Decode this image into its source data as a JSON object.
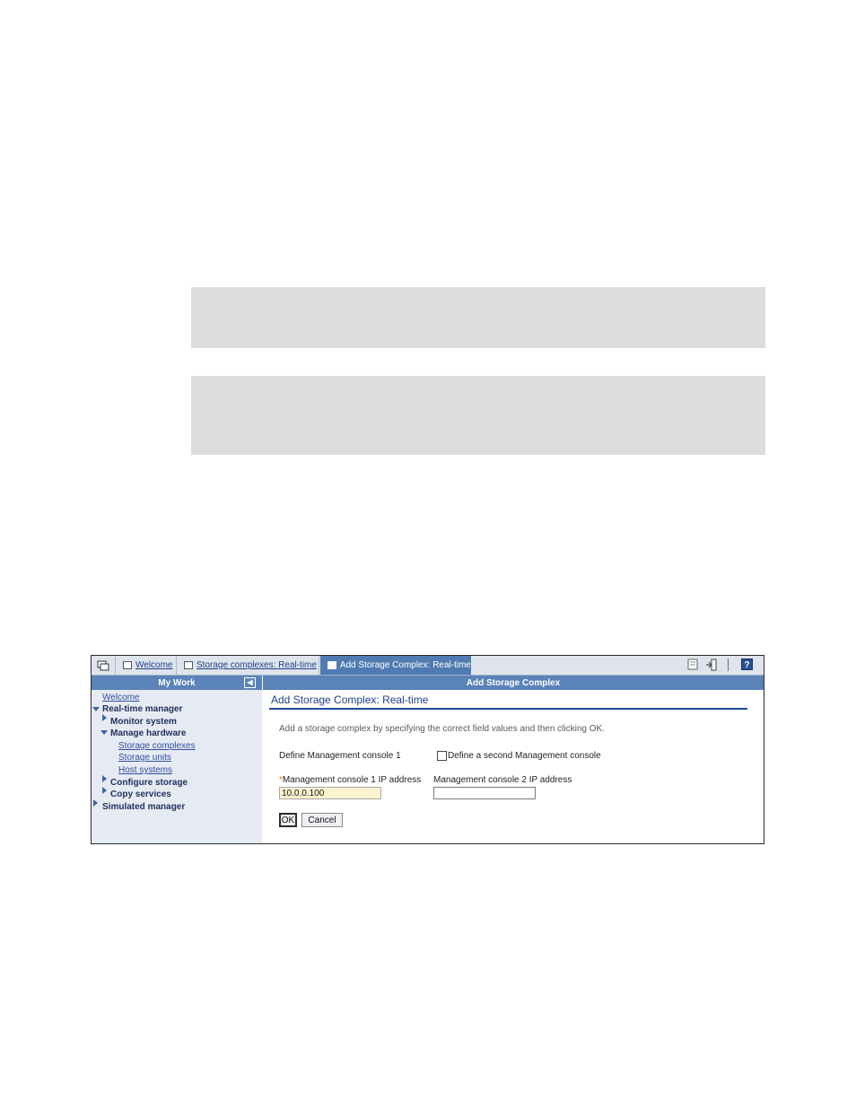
{
  "tabs": [
    {
      "label": "Welcome"
    },
    {
      "label": "Storage complexes: Real-time"
    },
    {
      "label": "Add Storage Complex: Real-time"
    }
  ],
  "nav": {
    "header": "My Work",
    "items": [
      {
        "label": "Welcome"
      },
      {
        "label": "Real-time manager"
      },
      {
        "label": "Monitor system"
      },
      {
        "label": "Manage hardware"
      },
      {
        "label": "Storage complexes"
      },
      {
        "label": "Storage units"
      },
      {
        "label": "Host systems"
      },
      {
        "label": "Configure storage"
      },
      {
        "label": "Copy services"
      },
      {
        "label": "Simulated manager"
      }
    ]
  },
  "main": {
    "header": "Add Storage Complex",
    "title": "Add Storage Complex: Real-time",
    "instructions": "Add a storage complex by specifying the correct field values and then clicking OK.",
    "define_label": "Define Management console 1",
    "checkbox_label": "Define a second Management console",
    "ip1_required_mark": "*",
    "ip1_label": "Management console 1 IP address",
    "ip1_value": "10.0.0.100",
    "ip2_label": "Management console 2 IP address",
    "ip2_value": "",
    "ok_label": "OK",
    "cancel_label": "Cancel"
  },
  "icons": [
    "windows-icon",
    "page-icon",
    "exit-icon",
    "help-icon",
    "collapse-icon"
  ],
  "colors": {
    "accent": "#5a83b9",
    "active_tab": "#4f7bb2",
    "title": "#1f3f8e",
    "nav_bg": "#e6ebf3"
  }
}
